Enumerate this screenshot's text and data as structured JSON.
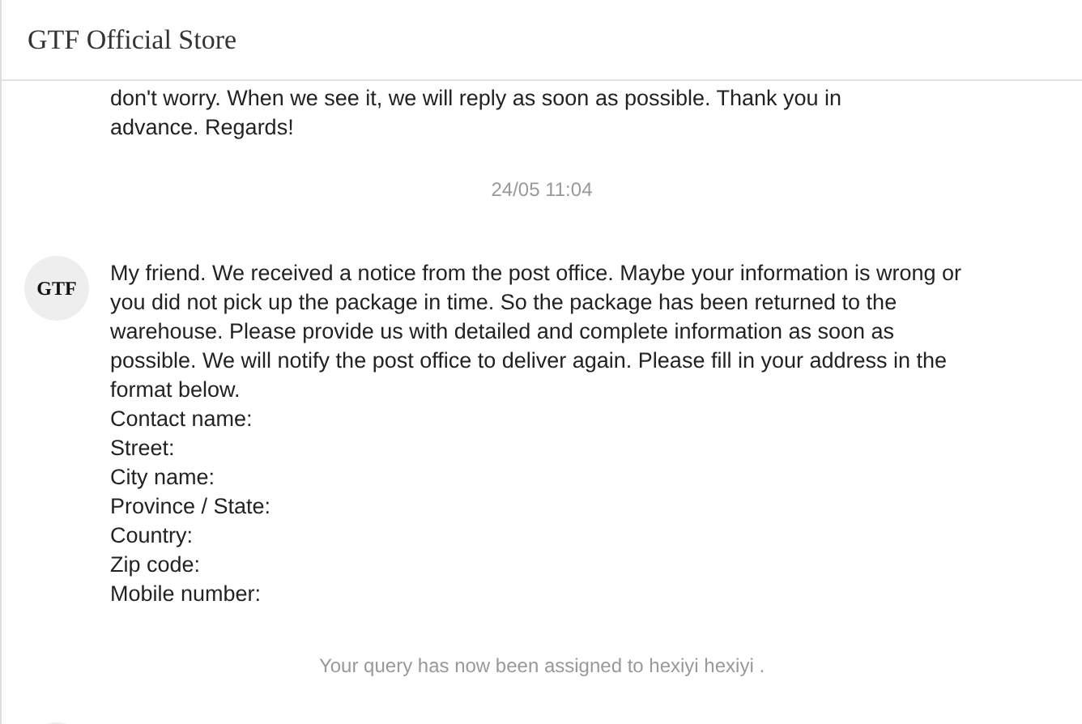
{
  "header": {
    "title": "GTF Official Store"
  },
  "messages": [
    {
      "kind": "text",
      "text": "don't worry.  When we see it, we will reply as soon as possible. Thank you in advance. Regards!"
    },
    {
      "kind": "time",
      "text": "24/05 11:04"
    },
    {
      "kind": "message",
      "avatar": "GTF",
      "lines": [
        "My friend. We received a notice from the post office. Maybe your information is wrong or you did not pick up the package in time. So the package has been returned to the warehouse. Please provide us with detailed and complete information as soon as possible. We will notify the post office to deliver again. Please fill in your address in the format below.",
        "Contact name:",
        "Street:",
        "City name:",
        "Province / State:",
        "Country:",
        "Zip code:",
        "Mobile number:"
      ]
    },
    {
      "kind": "notice",
      "text": "Your query has now been assigned to hexiyi hexiyi ."
    },
    {
      "kind": "avatar"
    }
  ]
}
